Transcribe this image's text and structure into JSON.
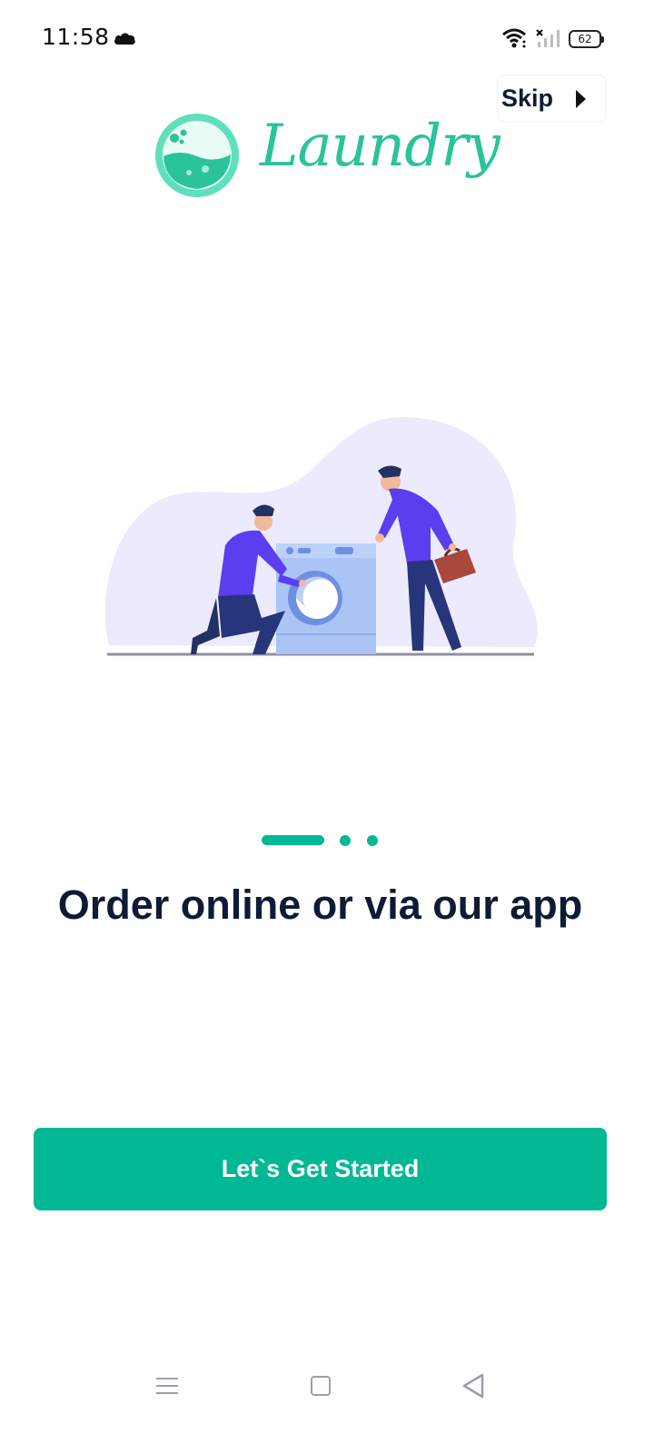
{
  "status_bar": {
    "time": "11:58",
    "battery": "62",
    "icons": [
      "cloud-icon",
      "wifi-icon",
      "signal-icon",
      "battery-icon"
    ]
  },
  "header": {
    "skip_label": "Skip",
    "logo_text": "Laundry"
  },
  "onboarding": {
    "illustration": "laundry-service-illustration",
    "page_indicator": {
      "current": 1,
      "total": 3
    },
    "headline": "Order online or via our app",
    "cta_label": "Let`s Get Started"
  },
  "nav_bar": {
    "icons": [
      "menu-icon",
      "home-icon",
      "back-icon"
    ]
  },
  "colors": {
    "accent": "#00b894",
    "logo": "#2bc39a",
    "heading": "#0f1b35",
    "blob": "#ecebfd"
  }
}
